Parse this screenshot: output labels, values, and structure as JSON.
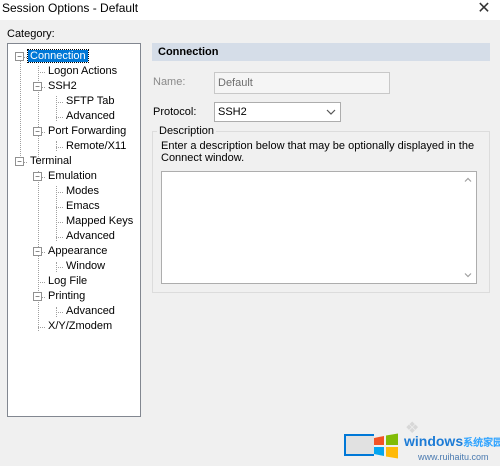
{
  "window": {
    "title": "Session Options - Default",
    "close_symbol": "✕"
  },
  "category": {
    "label": "Category:",
    "items": [
      {
        "label": "Connection",
        "level": 0,
        "expander": "−",
        "selected": true
      },
      {
        "label": "Logon Actions",
        "level": 1
      },
      {
        "label": "SSH2",
        "level": 1,
        "expander": "−"
      },
      {
        "label": "SFTP Tab",
        "level": 2
      },
      {
        "label": "Advanced",
        "level": 2
      },
      {
        "label": "Port Forwarding",
        "level": 1,
        "expander": "−"
      },
      {
        "label": "Remote/X11",
        "level": 2
      },
      {
        "label": "Terminal",
        "level": 0,
        "expander": "−"
      },
      {
        "label": "Emulation",
        "level": 1,
        "expander": "−"
      },
      {
        "label": "Modes",
        "level": 2
      },
      {
        "label": "Emacs",
        "level": 2
      },
      {
        "label": "Mapped Keys",
        "level": 2
      },
      {
        "label": "Advanced",
        "level": 2
      },
      {
        "label": "Appearance",
        "level": 1,
        "expander": "−"
      },
      {
        "label": "Window",
        "level": 2
      },
      {
        "label": "Log File",
        "level": 1
      },
      {
        "label": "Printing",
        "level": 1,
        "expander": "−"
      },
      {
        "label": "Advanced",
        "level": 2
      },
      {
        "label": "X/Y/Zmodem",
        "level": 1
      }
    ]
  },
  "panel": {
    "header": "Connection",
    "name_label": "Name:",
    "name_value": "Default",
    "protocol_label": "Protocol:",
    "protocol_value": "SSH2",
    "description_title": "Description",
    "description_hint": "Enter a description below that may be optionally displayed in the Connect window.",
    "description_value": ""
  },
  "watermark": {
    "brand": "windows",
    "brand_cn": "系统家园",
    "url": "www.ruihaitu.com"
  },
  "colors": {
    "selection": "#0078d7",
    "header_bg": "#d5dde8"
  }
}
